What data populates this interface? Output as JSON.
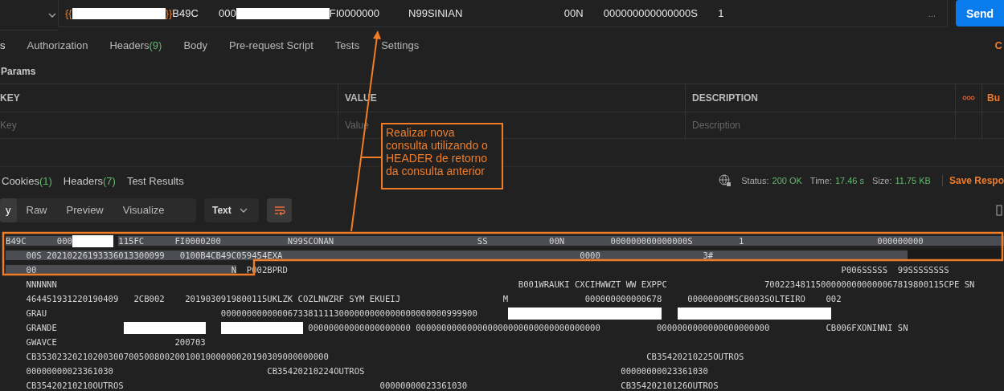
{
  "request": {
    "url": [
      {
        "kind": "var",
        "text": "{{"
      },
      {
        "kind": "redaction"
      },
      {
        "kind": "var",
        "text": "}}"
      },
      {
        "kind": "text",
        "text": "B49C       000"
      },
      {
        "kind": "redaction"
      },
      {
        "kind": "text",
        "text": "FI0000000          N99SINIAN                                   00N       000000000000000S       1"
      }
    ],
    "more": "...",
    "send": "Send"
  },
  "request_tabs": [
    {
      "label": "s",
      "selected": true
    },
    {
      "label": "Authorization",
      "selected": false
    },
    {
      "label": "Headers",
      "count": "(9)",
      "selected": false
    },
    {
      "label": "Body",
      "selected": false
    },
    {
      "label": "Pre-request Script",
      "selected": false
    },
    {
      "label": "Tests",
      "selected": false
    },
    {
      "label": "Settings",
      "selected": false
    }
  ],
  "cookies_link": "C",
  "params": {
    "title": "Params",
    "columns": [
      "KEY",
      "VALUE",
      "DESCRIPTION"
    ],
    "bulk_edit": "Bu",
    "placeholders": [
      "Key",
      "Value",
      "Description"
    ]
  },
  "response_tabs": [
    {
      "label": "Cookies",
      "count": "(1)"
    },
    {
      "label": "Headers",
      "count": "(7)"
    },
    {
      "label": "Test Results"
    }
  ],
  "status": [
    {
      "label": "Status:",
      "value": "200 OK"
    },
    {
      "label": "Time:",
      "value": "17.46 s"
    },
    {
      "label": "Size:",
      "value": "11.75 KB"
    }
  ],
  "save_response": "Save Respo",
  "format_tabs": [
    {
      "label": "y",
      "selected": true
    },
    {
      "label": "Raw",
      "selected": false
    },
    {
      "label": "Preview",
      "selected": false
    },
    {
      "label": "Visualize",
      "selected": false
    }
  ],
  "format": "Text",
  "body_lines": [
    [
      {
        "kind": "text",
        "text": "B49C      000",
        "selected": true
      },
      {
        "kind": "redaction"
      },
      {
        "kind": "text",
        "text": "115FC      FI0000200             N99SCONAN                            SS            00N         000000000000000S         1                          000000000",
        "selected": true
      }
    ],
    [
      {
        "kind": "text",
        "text": "    00S 20210226193336013300099   0100B4CB49C059454EXA                                                          0000                    3#",
        "selected": true
      },
      {
        "kind": "blackout"
      }
    ],
    [
      {
        "kind": "text",
        "text": "    00                                      N",
        "selected": true
      },
      {
        "kind": "text",
        "text": "  P002BPRD                                                                                                            P006SSSSS  99SSSSSSSS",
        "selected": false
      }
    ],
    [
      {
        "kind": "text",
        "text": "    NNNNNN                                                                                          B001WRAUKI CXCIHWWZT WW EXPPC                   70022348115000000000000067819800115CPE SN",
        "selected": false
      }
    ],
    [
      {
        "kind": "text",
        "text": "    464451931220190409   2CB002    2019030919800115UKLZK COZLNWZRF SYM EKUEIJ                    M               000000000000678     00000000MSCB003SOLTEIRO    002",
        "selected": false
      }
    ],
    [
      {
        "kind": "text",
        "text": "    GRAU                                  00000000000006733811113000000000000000000000999900",
        "selected": false
      },
      {
        "kind": "long-redaction"
      },
      {
        "kind": "long-redaction"
      }
    ],
    [
      {
        "kind": "text",
        "text": "    GRANDE",
        "selected": false
      },
      {
        "kind": "wide-redaction"
      },
      {
        "kind": "wide-redaction"
      },
      {
        "kind": "text",
        "text": "00000000000000000000 000000000000000000000000000000000000           0000000000000000000000           CB006FXONINNI SN",
        "selected": false
      }
    ],
    [
      {
        "kind": "text",
        "text": "    GWAVCE                       200703",
        "selected": false
      }
    ],
    [
      {
        "kind": "text",
        "text": "    CB353023202102003007005008002001001000000020190309000000000                                                              CB35420210225OUTROS",
        "selected": false
      }
    ],
    [
      {
        "kind": "text",
        "text": "    00000000023361030                              CB35420210224OUTROS                                                  00000000023361030",
        "selected": false
      }
    ],
    [
      {
        "kind": "text",
        "text": "    CB35420210210OUTROS                                                  00000000023361030                              CB35420210126OUTROS",
        "selected": false
      }
    ]
  ],
  "annotation": {
    "text": "Realizar nova consulta utilizando o HEADER de retorno da consulta anterior"
  }
}
